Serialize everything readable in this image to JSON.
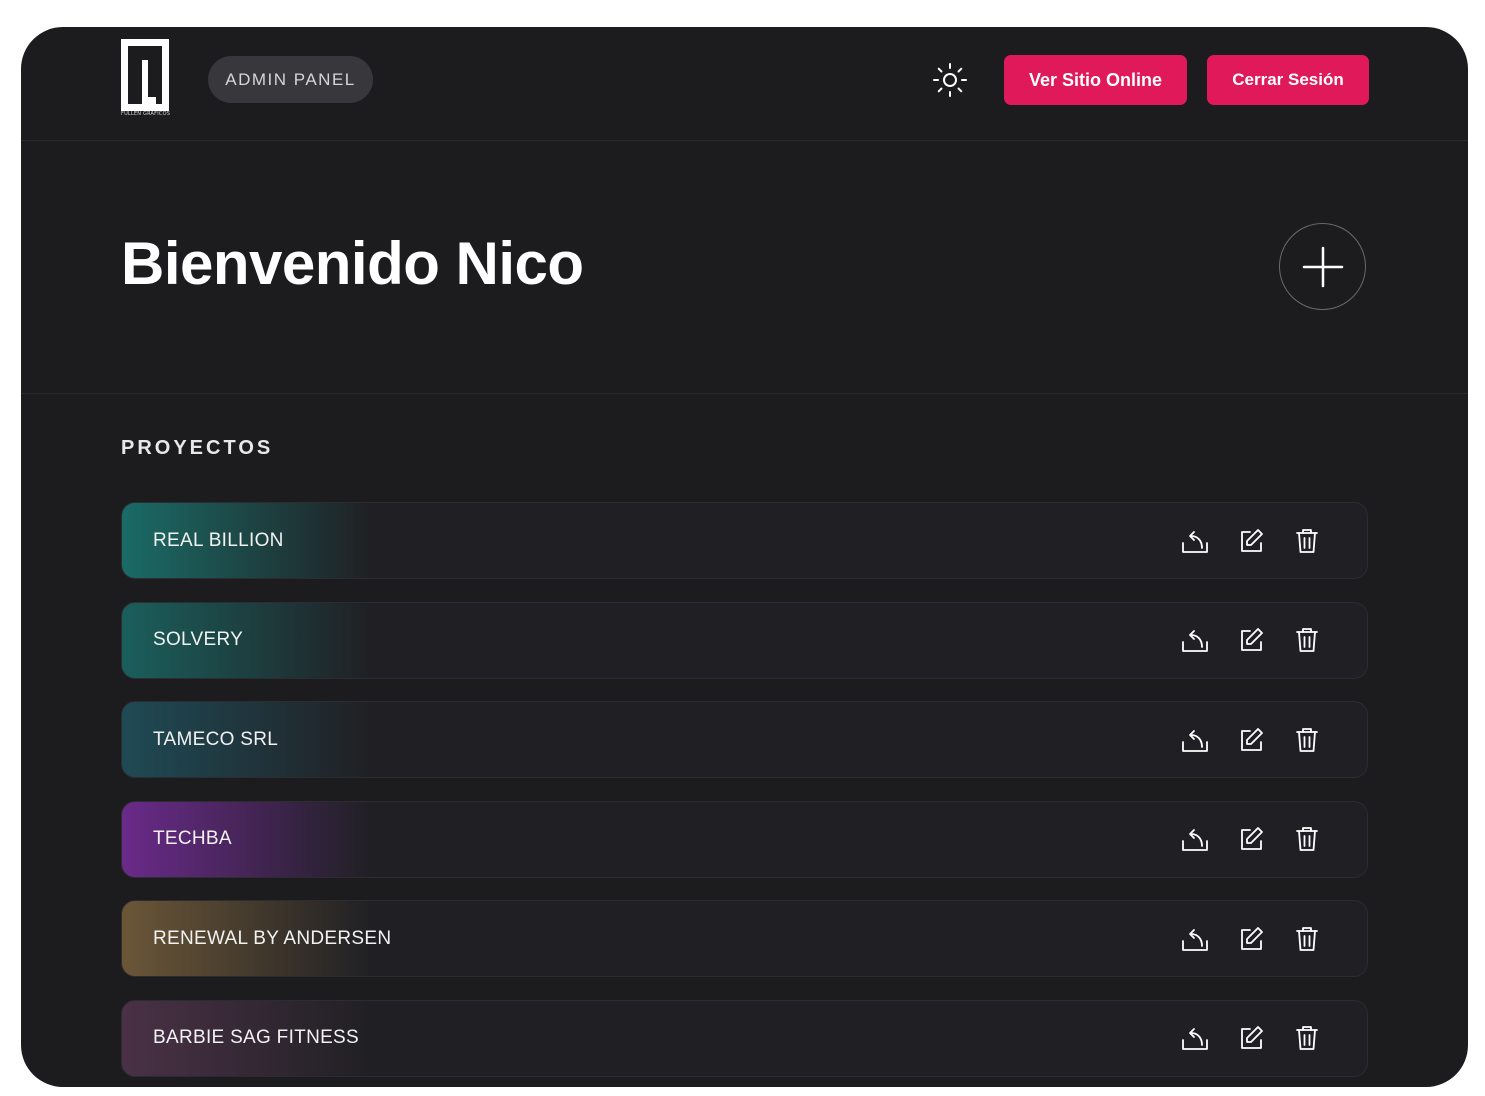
{
  "header": {
    "logo_text": "FULLEN GRAFICOS",
    "admin_label": "ADMIN PANEL",
    "theme_icon": "sun-icon",
    "view_site_label": "Ver Sitio Online",
    "logout_label": "Cerrar Sesión"
  },
  "hero": {
    "welcome": "Bienvenido Nico",
    "add_icon": "plus-icon"
  },
  "projects": {
    "title": "PROYECTOS",
    "items": [
      {
        "name": "REAL BILLION",
        "accent": "#1a6b66"
      },
      {
        "name": "SOLVERY",
        "accent": "#1a5f5c"
      },
      {
        "name": "TAMECO SRL",
        "accent": "#1f4a55"
      },
      {
        "name": "TECHBA",
        "accent": "#6a2a8a"
      },
      {
        "name": "RENEWAL BY ANDERSEN",
        "accent": "#6b5637"
      },
      {
        "name": "BARBIE SAG FITNESS",
        "accent": "#4a3146"
      }
    ]
  },
  "colors": {
    "background": "#1c1c1f",
    "primary": "#e0195a"
  }
}
